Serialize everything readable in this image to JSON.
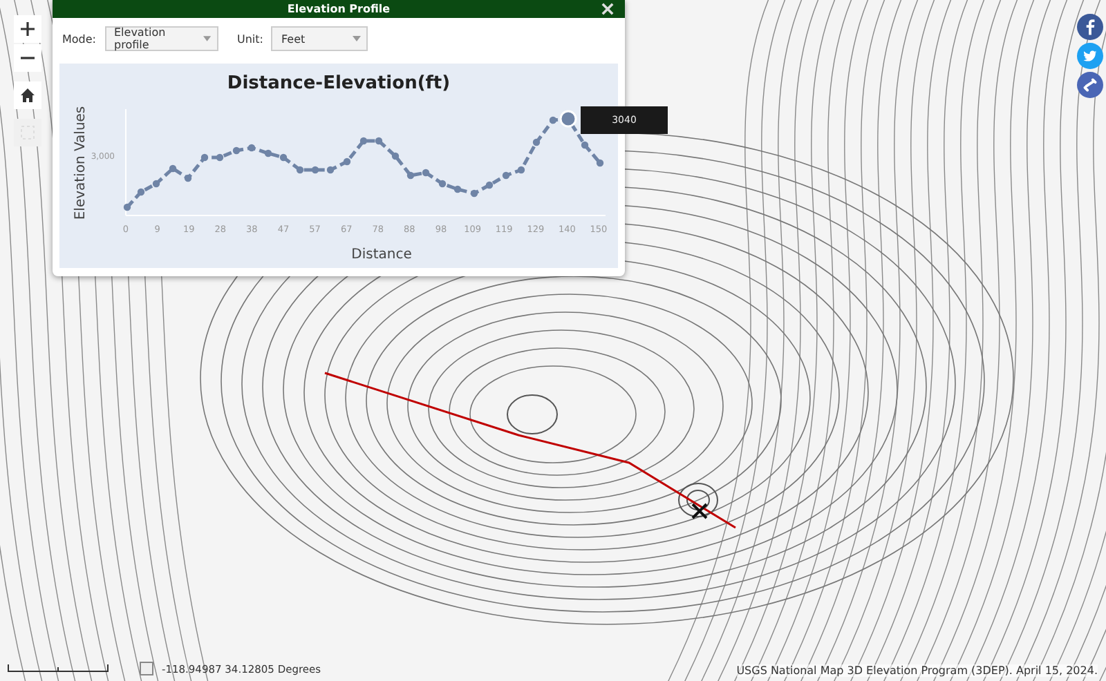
{
  "panel": {
    "title": "Elevation Profile",
    "mode": {
      "label": "Mode:",
      "value": "Elevation profile"
    },
    "unit": {
      "label": "Unit:",
      "value": "Feet"
    }
  },
  "chart": {
    "title": "Distance-Elevation(ft)",
    "ylabel": "Elevation Values",
    "xlabel": "Distance",
    "ytick": "3,000",
    "xticks": [
      "0",
      "9",
      "19",
      "28",
      "38",
      "47",
      "57",
      "67",
      "78",
      "88",
      "98",
      "109",
      "119",
      "129",
      "140",
      "150"
    ],
    "tooltip": "3040"
  },
  "map": {
    "coordinates": "-118.94987  34.12805 Degrees",
    "attribution": "USGS National Map 3D Elevation Program (3DEP). April 15, 2024."
  }
}
